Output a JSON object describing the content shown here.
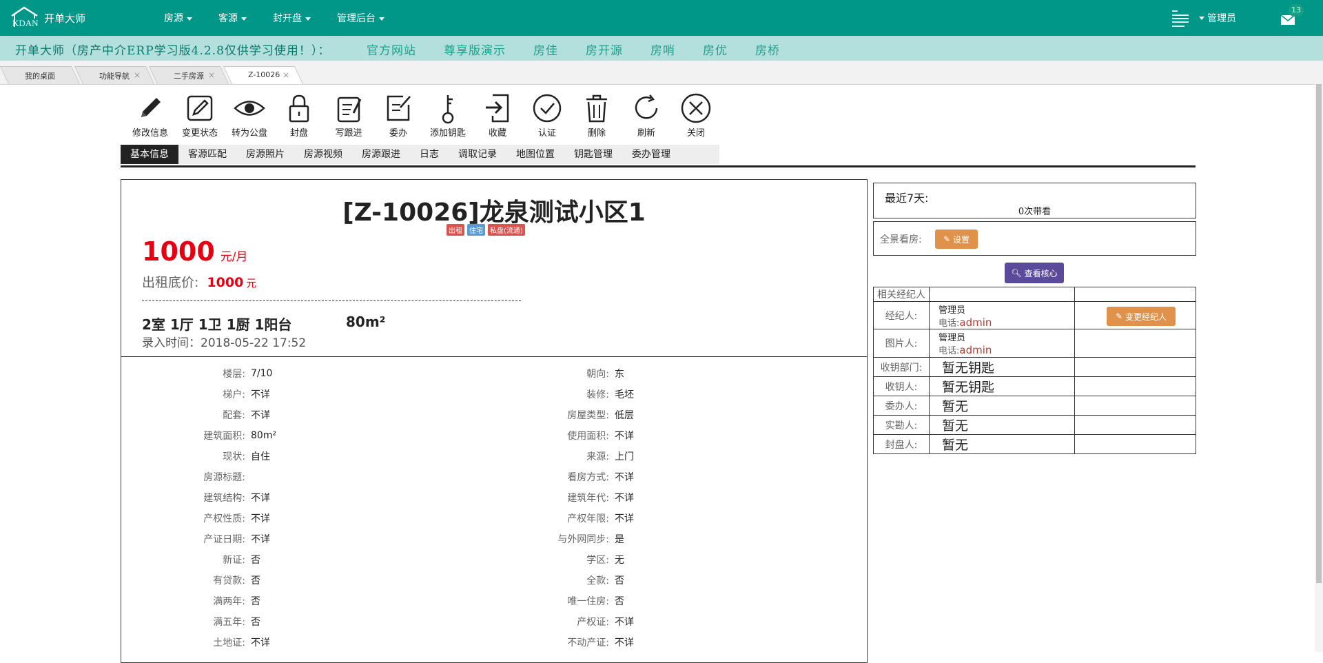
{
  "app": {
    "logo_text": "开单大师",
    "nav": [
      {
        "label": "房源"
      },
      {
        "label": "客源"
      },
      {
        "label": "封开盘"
      },
      {
        "label": "管理后台"
      }
    ],
    "user": "管理员",
    "mail_count": "13",
    "brand_color": "#009688"
  },
  "notice": {
    "text": "开单大师（房产中介ERP学习版4.2.8仅供学习使用！）：",
    "links": [
      "官方网站",
      "尊享版演示",
      "房佳",
      "房开源",
      "房哨",
      "房优",
      "房桥"
    ]
  },
  "tabs": [
    {
      "label": "我的桌面",
      "closable": false
    },
    {
      "label": "功能导航",
      "closable": true
    },
    {
      "label": "二手房源",
      "closable": true
    },
    {
      "label": "Z-10026",
      "closable": true,
      "active": true
    }
  ],
  "toolbar": [
    {
      "label": "修改信息",
      "icon": "pencil-icon"
    },
    {
      "label": "变更状态",
      "icon": "edit-icon"
    },
    {
      "label": "转为公盘",
      "icon": "eye-icon"
    },
    {
      "label": "封盘",
      "icon": "lock-icon"
    },
    {
      "label": "写跟进",
      "icon": "notepad-icon"
    },
    {
      "label": "委办",
      "icon": "edit-square-icon"
    },
    {
      "label": "添加钥匙",
      "icon": "key-icon"
    },
    {
      "label": "收藏",
      "icon": "export-icon"
    },
    {
      "label": "认证",
      "icon": "check-circle-icon"
    },
    {
      "label": "删除",
      "icon": "trash-icon"
    },
    {
      "label": "刷新",
      "icon": "refresh-icon"
    },
    {
      "label": "关闭",
      "icon": "close-circle-icon"
    }
  ],
  "subtabs": [
    "基本信息",
    "客源匹配",
    "房源照片",
    "房源视频",
    "房源跟进",
    "日志",
    "调取记录",
    "地图位置",
    "钥匙管理",
    "委办管理"
  ],
  "property": {
    "title": "[Z-10026]龙泉测试小区1",
    "tags": [
      {
        "text": "出租",
        "color": "#d9534f"
      },
      {
        "text": "住宅",
        "color": "#5b9bd5"
      },
      {
        "text": "私盘(流通)",
        "color": "#d9534f"
      }
    ],
    "price": "1000",
    "price_unit": "元/月",
    "low_label": "出租底价:",
    "low_price": "1000",
    "low_unit": "元",
    "layout": "2室 1厅 1卫 1厨 1阳台",
    "area": "80m²",
    "entered": "录入时间：2018-05-22 17:52"
  },
  "details_left": [
    {
      "k": "楼层:",
      "v": "7/10"
    },
    {
      "k": "梯户:",
      "v": "不详"
    },
    {
      "k": "配套:",
      "v": "不详"
    },
    {
      "k": "建筑面积:",
      "v": "80m²"
    },
    {
      "k": "现状:",
      "v": "自住"
    },
    {
      "k": "房源标题:",
      "v": ""
    },
    {
      "k": "建筑结构:",
      "v": "不详"
    },
    {
      "k": "产权性质:",
      "v": "不详"
    },
    {
      "k": "产证日期:",
      "v": "不详"
    },
    {
      "k": "新证:",
      "v": "否"
    },
    {
      "k": "有贷款:",
      "v": "否"
    },
    {
      "k": "满两年:",
      "v": "否"
    },
    {
      "k": "满五年:",
      "v": "否"
    },
    {
      "k": "土地证:",
      "v": "不详"
    }
  ],
  "details_right": [
    {
      "k": "朝向:",
      "v": "东"
    },
    {
      "k": "装修:",
      "v": "毛坯"
    },
    {
      "k": "房屋类型:",
      "v": "低层"
    },
    {
      "k": "使用面积:",
      "v": "不详"
    },
    {
      "k": "来源:",
      "v": "上门"
    },
    {
      "k": "看房方式:",
      "v": "不详"
    },
    {
      "k": "建筑年代:",
      "v": "不详"
    },
    {
      "k": "产权年限:",
      "v": "不详"
    },
    {
      "k": "与外网同步:",
      "v": "是"
    },
    {
      "k": "学区:",
      "v": "无"
    },
    {
      "k": "全款:",
      "v": "否"
    },
    {
      "k": "唯一住房:",
      "v": "否"
    },
    {
      "k": "产权证:",
      "v": "不详"
    },
    {
      "k": "不动产证:",
      "v": "不详"
    }
  ],
  "side": {
    "recent_label": "最近7天:",
    "recent_count": "0次带看",
    "vr_label": "全景看房:",
    "vr_button": "设置",
    "core_button": "查看核心",
    "agents_header": "相关经纪人",
    "agent_label": "经纪人:",
    "agent_name": "管理员",
    "agent_phone_label": "电话:",
    "agent_phone": "admin",
    "change_button": "变更经纪人",
    "photo_label": "图片人:",
    "photo_name": "管理员",
    "photo_phone_label": "电话:",
    "photo_phone": "admin",
    "key_dept_label": "收钥部门:",
    "key_dept": "暂无钥匙",
    "key_person_label": "收钥人:",
    "key_person": "暂无钥匙",
    "delegate_label": "委办人:",
    "delegate": "暂无",
    "survey_label": "实勘人:",
    "survey": "暂无",
    "seal_label": "封盘人:",
    "seal": "暂无"
  }
}
